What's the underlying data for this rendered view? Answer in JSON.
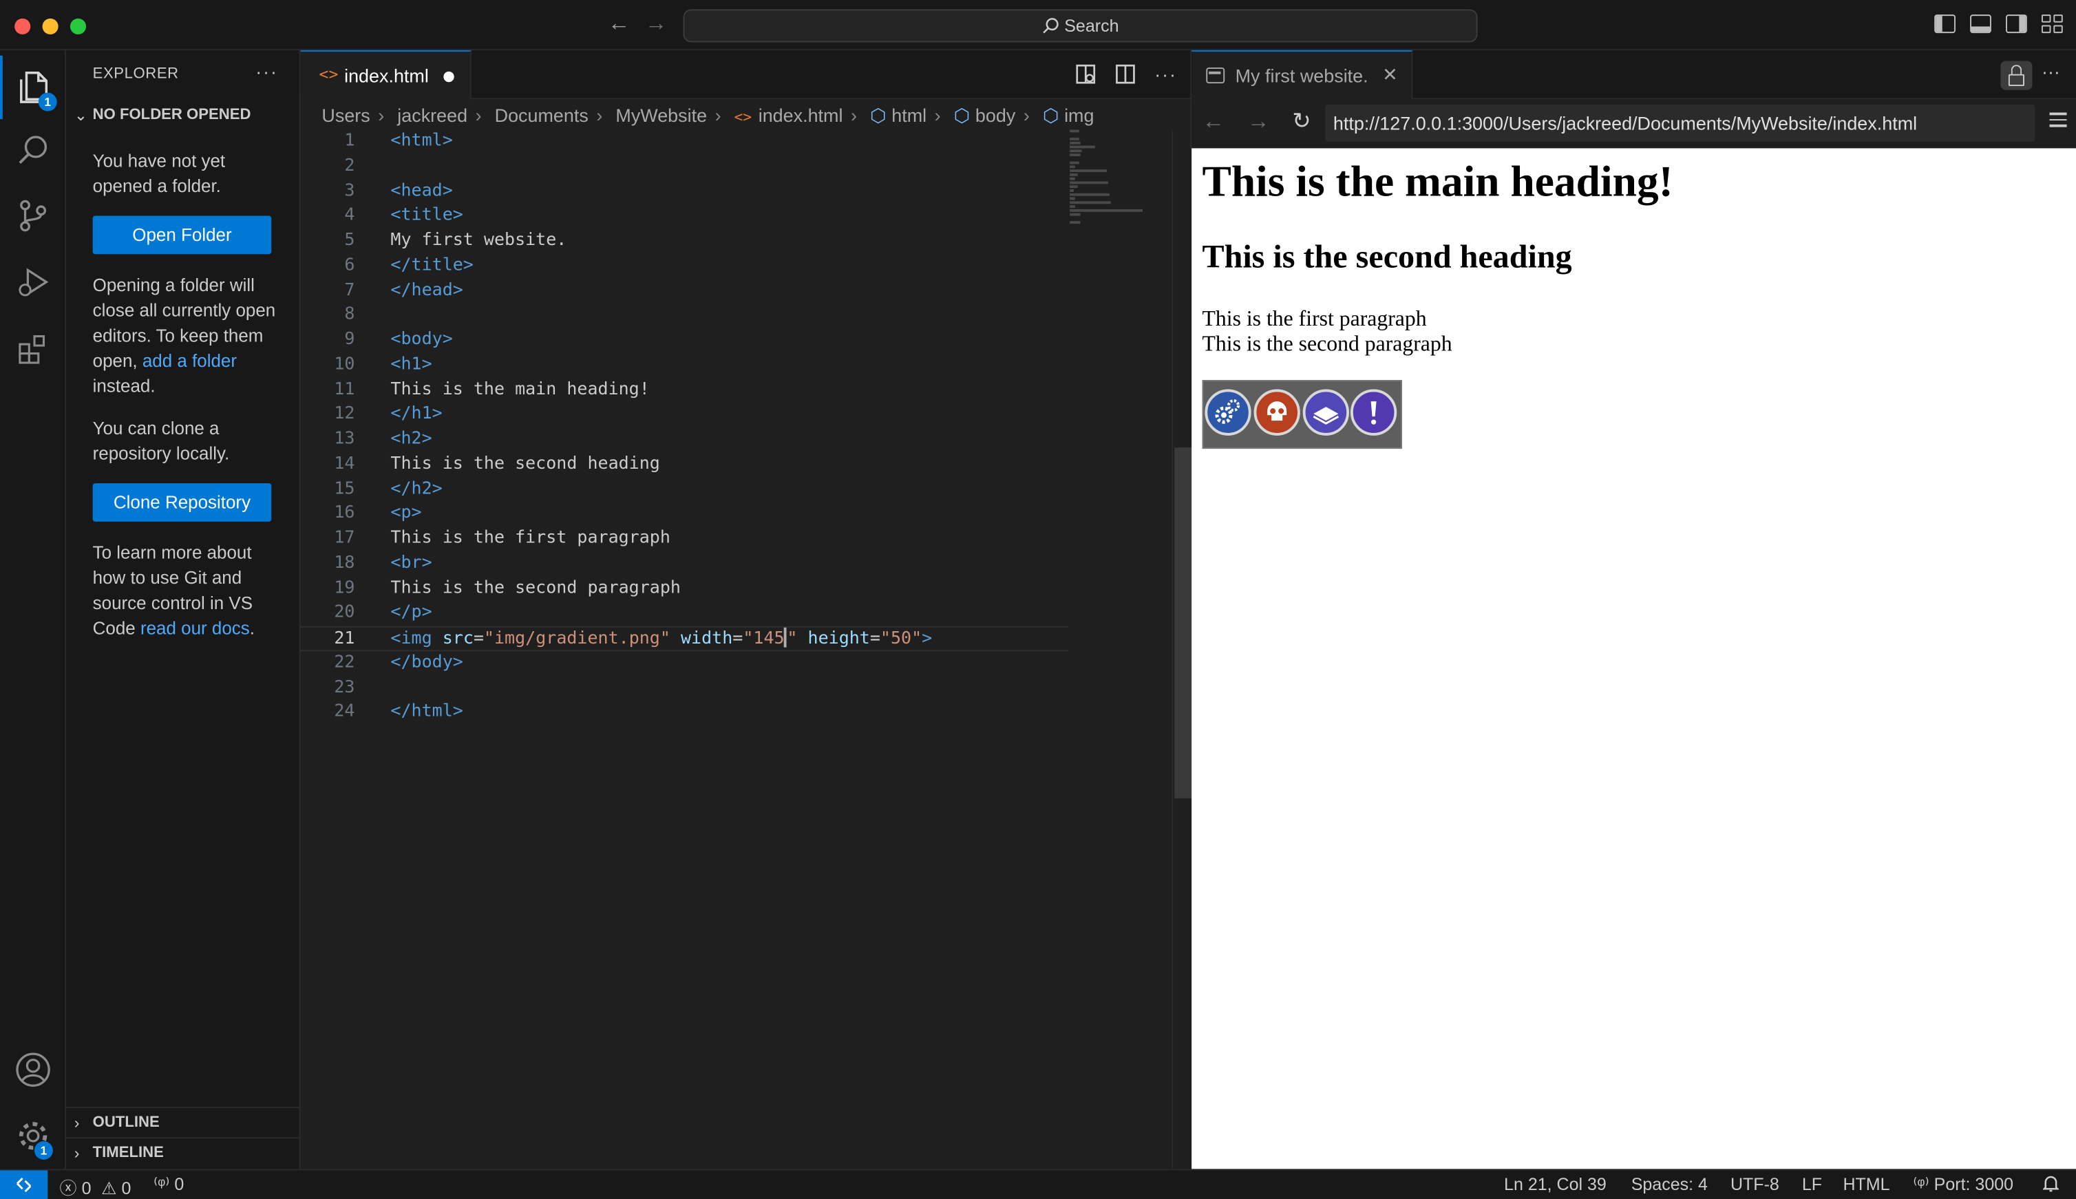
{
  "titlebar": {
    "search_label": "Search"
  },
  "activity": {
    "explorer_badge": "1",
    "settings_badge": "1"
  },
  "sidebar": {
    "title": "EXPLORER",
    "more": "···",
    "section_no_folder": "NO FOLDER OPENED",
    "msg_not_opened": "You have not yet opened a folder.",
    "open_folder_button": "Open Folder",
    "msg_opening_prefix": "Opening a folder will close all currently open editors. To keep them open, ",
    "msg_opening_link": "add a folder",
    "msg_opening_suffix": " instead.",
    "msg_clone": "You can clone a repository locally.",
    "clone_button": "Clone Repository",
    "msg_learn_prefix": "To learn more about how to use Git and source control in VS Code ",
    "msg_learn_link": "read our docs",
    "msg_learn_suffix": ".",
    "section_outline": "OUTLINE",
    "section_timeline": "TIMELINE"
  },
  "editor": {
    "tab_label": "index.html",
    "breadcrumb": [
      "Users",
      "jackreed",
      "Documents",
      "MyWebsite",
      "index.html",
      "html",
      "body",
      "img"
    ],
    "current_line": 21,
    "lines": [
      {
        "n": "1",
        "parts": [
          {
            "c": "tagc",
            "t": "<html>"
          }
        ]
      },
      {
        "n": "2",
        "parts": []
      },
      {
        "n": "3",
        "parts": [
          {
            "c": "tagc",
            "t": "<head>"
          }
        ]
      },
      {
        "n": "4",
        "parts": [
          {
            "c": "tagc",
            "t": "<title>"
          }
        ]
      },
      {
        "n": "5",
        "parts": [
          {
            "c": "txt",
            "t": "My first website."
          }
        ]
      },
      {
        "n": "6",
        "parts": [
          {
            "c": "tagc",
            "t": "</title>"
          }
        ]
      },
      {
        "n": "7",
        "parts": [
          {
            "c": "tagc",
            "t": "</head>"
          }
        ]
      },
      {
        "n": "8",
        "parts": []
      },
      {
        "n": "9",
        "parts": [
          {
            "c": "tagc",
            "t": "<body>"
          }
        ]
      },
      {
        "n": "10",
        "parts": [
          {
            "c": "tagc",
            "t": "<h1>"
          }
        ]
      },
      {
        "n": "11",
        "parts": [
          {
            "c": "txt",
            "t": "This is the main heading!"
          }
        ]
      },
      {
        "n": "12",
        "parts": [
          {
            "c": "tagc",
            "t": "</h1>"
          }
        ]
      },
      {
        "n": "13",
        "parts": [
          {
            "c": "tagc",
            "t": "<h2>"
          }
        ]
      },
      {
        "n": "14",
        "parts": [
          {
            "c": "txt",
            "t": "This is the second heading"
          }
        ]
      },
      {
        "n": "15",
        "parts": [
          {
            "c": "tagc",
            "t": "</h2>"
          }
        ]
      },
      {
        "n": "16",
        "parts": [
          {
            "c": "tagc",
            "t": "<p>"
          }
        ]
      },
      {
        "n": "17",
        "parts": [
          {
            "c": "txt",
            "t": "This is the first paragraph"
          }
        ]
      },
      {
        "n": "18",
        "parts": [
          {
            "c": "tagc",
            "t": "<br>"
          }
        ]
      },
      {
        "n": "19",
        "parts": [
          {
            "c": "txt",
            "t": "This is the second paragraph"
          }
        ]
      },
      {
        "n": "20",
        "parts": [
          {
            "c": "tagc",
            "t": "</p>"
          }
        ]
      },
      {
        "n": "21",
        "parts": [
          {
            "c": "tagc",
            "t": "<img "
          },
          {
            "c": "attr",
            "t": "src"
          },
          {
            "c": "txt",
            "t": "="
          },
          {
            "c": "str",
            "t": "\"img/gradient.png\""
          },
          {
            "c": "txt",
            "t": " "
          },
          {
            "c": "attr",
            "t": "width"
          },
          {
            "c": "txt",
            "t": "="
          },
          {
            "c": "str",
            "t": "\"145"
          },
          {
            "c": "cursor",
            "t": ""
          },
          {
            "c": "str",
            "t": "\""
          },
          {
            "c": "txt",
            "t": " "
          },
          {
            "c": "attr",
            "t": "height"
          },
          {
            "c": "txt",
            "t": "="
          },
          {
            "c": "str",
            "t": "\"50\""
          },
          {
            "c": "tagc",
            "t": ">"
          }
        ]
      },
      {
        "n": "22",
        "parts": [
          {
            "c": "tagc",
            "t": "</body>"
          }
        ]
      },
      {
        "n": "23",
        "parts": []
      },
      {
        "n": "24",
        "parts": [
          {
            "c": "tagc",
            "t": "</html>"
          }
        ]
      }
    ]
  },
  "browser": {
    "tab_label": "My first website.",
    "url": "http://127.0.0.1:3000/Users/jackreed/Documents/MyWebsite/index.html",
    "page": {
      "h1": "This is the main heading!",
      "h2": "This is the second heading",
      "p1": "This is the first paragraph",
      "p2": "This is the second paragraph",
      "image_icons": [
        "gears-icon",
        "skull-icon",
        "book-icon",
        "exclamation-icon"
      ]
    }
  },
  "statusbar": {
    "errors": "0",
    "warnings": "0",
    "ports_count": "0",
    "position": "Ln 21, Col 39",
    "spaces": "Spaces: 4",
    "encoding": "UTF-8",
    "eol": "LF",
    "language": "HTML",
    "port": "Port: 3000"
  },
  "colors": {
    "accent": "#0078d4",
    "link": "#4daafc",
    "tag": "#569cd6",
    "attribute": "#9cdcfe",
    "string": "#ce9178"
  }
}
